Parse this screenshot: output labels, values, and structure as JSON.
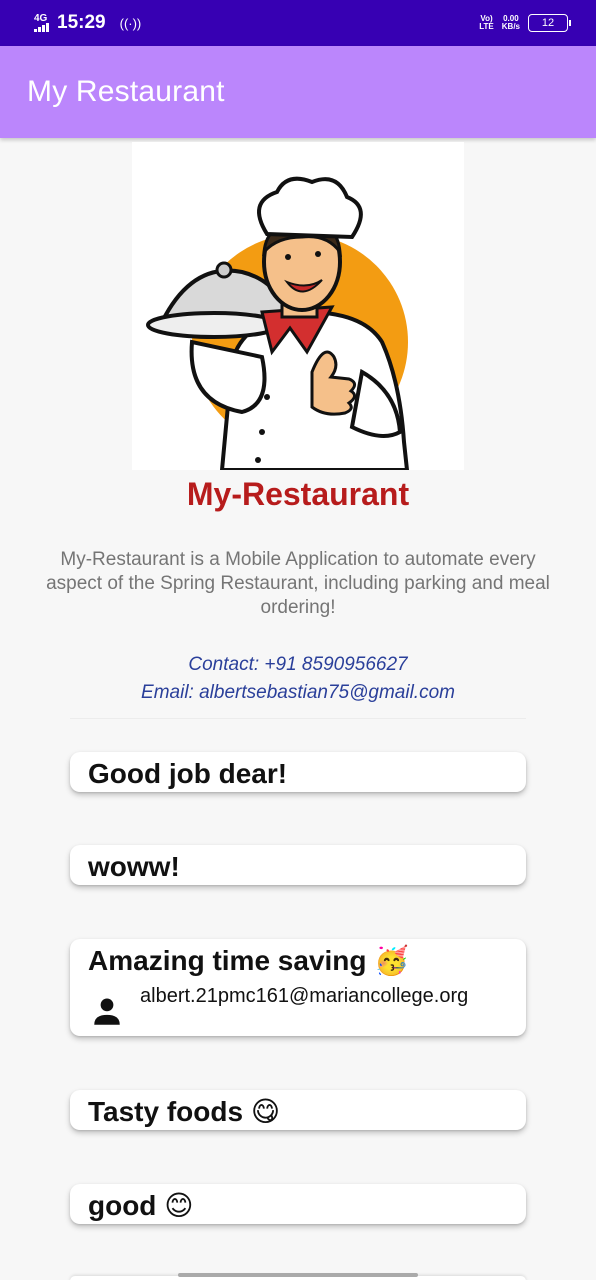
{
  "status_bar": {
    "network": "4G",
    "time": "15:29",
    "volte": "Vo)",
    "lte": "LTE",
    "speed_value": "0.00",
    "speed_unit": "KB/s",
    "battery": "12"
  },
  "app_bar": {
    "title": "My Restaurant"
  },
  "hero": {
    "icon": "chef-illustration",
    "accent_color": "#f39c12"
  },
  "brand": {
    "name": "My-Restaurant",
    "color": "#b71c1c"
  },
  "description": "My-Restaurant is a Mobile Application to automate every aspect of the Spring Restaurant, including parking and meal ordering!",
  "contact": {
    "phone": "Contact: +91 8590956627",
    "email": "Email: albertsebastian75@gmail.com"
  },
  "reviews": [
    {
      "text": "Good job dear!"
    },
    {
      "text": "woww!"
    },
    {
      "text": "Amazing time saving 🥳",
      "user_email": "albert.21pmc161@mariancollege.org",
      "user_icon": "person-icon"
    },
    {
      "text": "Tasty foods 😋"
    },
    {
      "text": "good 😊"
    }
  ]
}
